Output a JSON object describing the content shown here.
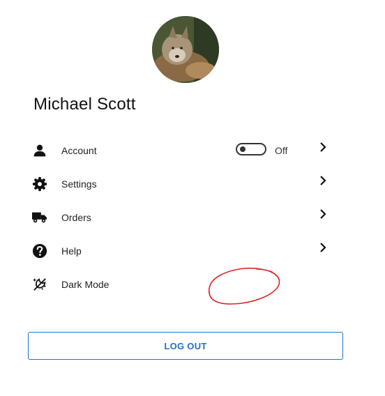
{
  "profile": {
    "avatar_icon": "wolf-photo-avatar",
    "name": "Michael Scott"
  },
  "menu": {
    "items": [
      {
        "icon": "person-icon",
        "label": "Account"
      },
      {
        "icon": "gear-icon",
        "label": "Settings"
      },
      {
        "icon": "truck-icon",
        "label": "Orders"
      },
      {
        "icon": "help-circle-icon",
        "label": "Help"
      }
    ],
    "dark_mode": {
      "icon": "dark-mode-icon",
      "label": "Dark Mode",
      "state_label": "Off",
      "enabled": false
    }
  },
  "actions": {
    "logout_label": "LOG OUT"
  },
  "colors": {
    "accent": "#1f6fd1",
    "annotation": "#e02020",
    "text": "#222222"
  }
}
